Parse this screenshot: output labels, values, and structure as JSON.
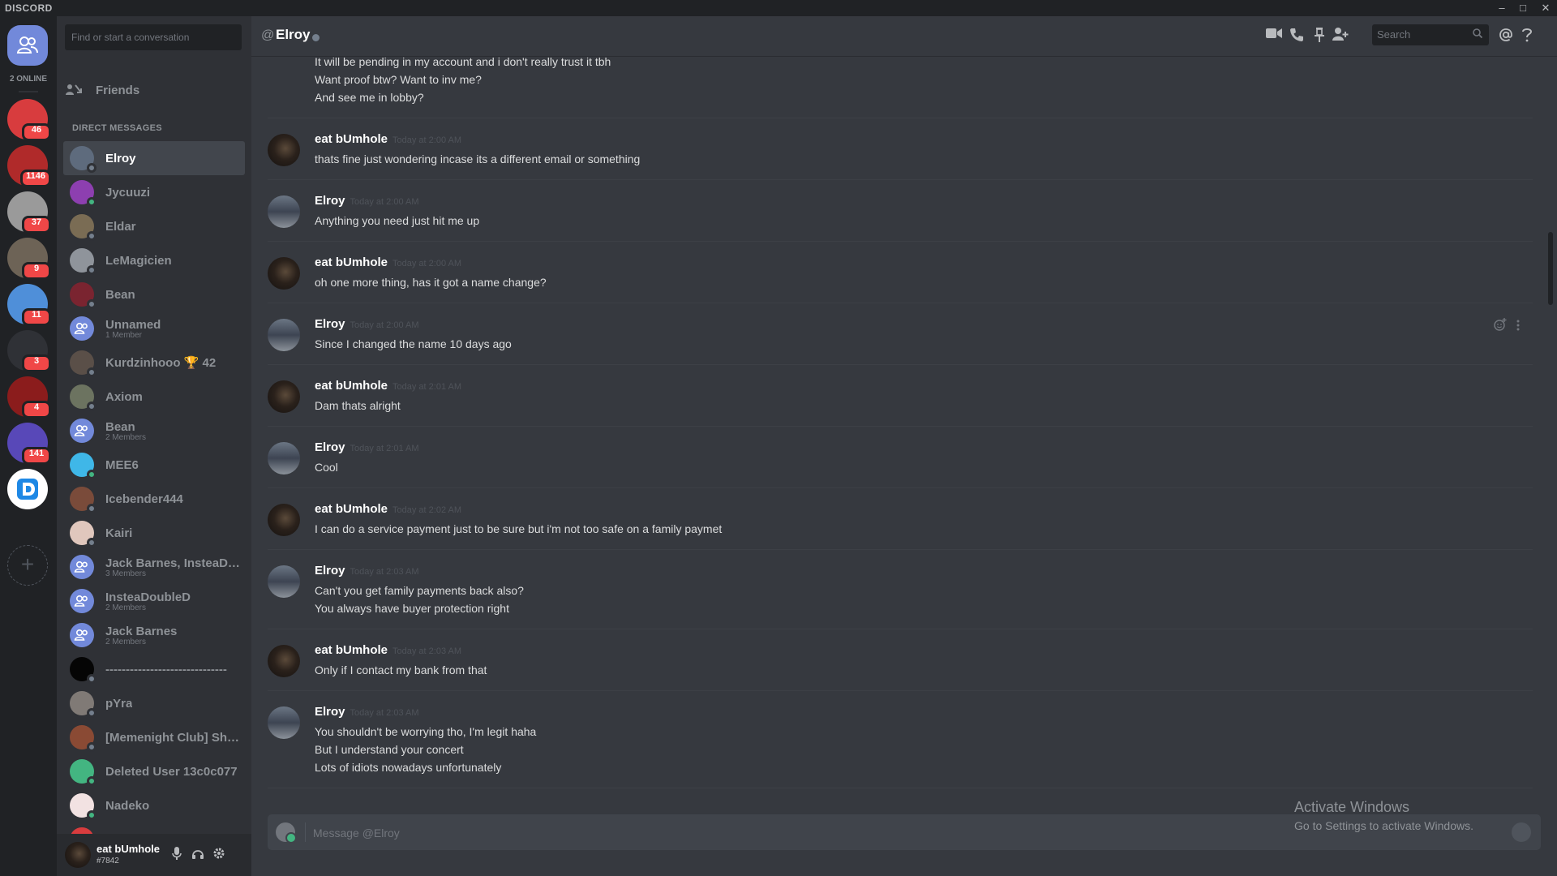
{
  "app": {
    "brand": "DISCORD"
  },
  "window_controls": {
    "minimize": "–",
    "maximize": "□",
    "close": "✕"
  },
  "rail": {
    "online_count": "2 ONLINE",
    "guilds": [
      {
        "name": "guild-1",
        "badge": "46",
        "color": "#d83c3e"
      },
      {
        "name": "guild-2",
        "badge": "1146",
        "color": "#b02a2a"
      },
      {
        "name": "guild-3",
        "badge": "37",
        "color": "#9a9a9a"
      },
      {
        "name": "guild-4",
        "badge": "9",
        "color": "#6d6356"
      },
      {
        "name": "guild-5",
        "badge": "11",
        "color": "#4f8fd9"
      },
      {
        "name": "guild-6",
        "badge": "3",
        "color": "#2f3136"
      },
      {
        "name": "guild-7",
        "badge": "4",
        "color": "#8b1c1c"
      },
      {
        "name": "guild-8",
        "badge": "141",
        "color": "#5848b8"
      },
      {
        "name": "guild-9",
        "badge": "",
        "color": "#ffffff"
      }
    ]
  },
  "dm": {
    "search_placeholder": "Find or start a conversation",
    "friends_label": "Friends",
    "header": "DIRECT MESSAGES",
    "items": [
      {
        "name": "Elroy",
        "sub": "",
        "active": true,
        "online": false,
        "color": "#5e6b7d"
      },
      {
        "name": "Jycuuzi",
        "sub": "",
        "active": false,
        "online": true,
        "color": "#8d3fb0"
      },
      {
        "name": "Eldar",
        "sub": "",
        "active": false,
        "online": false,
        "color": "#7a6c54"
      },
      {
        "name": "LeMagicien",
        "sub": "",
        "active": false,
        "online": false,
        "color": "#8f949b"
      },
      {
        "name": "Bean",
        "sub": "",
        "active": false,
        "online": false,
        "color": "#7a2430"
      },
      {
        "name": "Unnamed",
        "sub": "1 Member",
        "active": false,
        "online": false,
        "color": "#7289da"
      },
      {
        "name": "Kurdzinhooo 🏆 42",
        "sub": "",
        "active": false,
        "online": false,
        "color": "#5a4f48"
      },
      {
        "name": "Axiom",
        "sub": "",
        "active": false,
        "online": false,
        "color": "#6c7360"
      },
      {
        "name": "Bean",
        "sub": "2 Members",
        "active": false,
        "online": false,
        "color": "#7289da"
      },
      {
        "name": "MEE6",
        "sub": "",
        "active": false,
        "online": true,
        "color": "#3fb7e8"
      },
      {
        "name": "Icebender444",
        "sub": "",
        "active": false,
        "online": false,
        "color": "#7a4b3a"
      },
      {
        "name": "Kairi",
        "sub": "",
        "active": false,
        "online": false,
        "color": "#e0c7bd"
      },
      {
        "name": "Jack Barnes, InsteaDoub...",
        "sub": "3 Members",
        "active": false,
        "online": false,
        "color": "#7289da"
      },
      {
        "name": "InsteaDoubleD",
        "sub": "2 Members",
        "active": false,
        "online": false,
        "color": "#7289da"
      },
      {
        "name": "Jack Barnes",
        "sub": "2 Members",
        "active": false,
        "online": false,
        "color": "#7289da"
      },
      {
        "name": "------------------------------",
        "sub": "",
        "active": false,
        "online": false,
        "color": "#050505"
      },
      {
        "name": "pYra",
        "sub": "",
        "active": false,
        "online": false,
        "color": "#807a76"
      },
      {
        "name": "[Memenight Club] Shai ...",
        "sub": "",
        "active": false,
        "online": false,
        "color": "#8a4a34"
      },
      {
        "name": "Deleted User 13c0c077",
        "sub": "",
        "active": false,
        "online": true,
        "color": "#43b581"
      },
      {
        "name": "Nadeko",
        "sub": "",
        "active": false,
        "online": true,
        "color": "#f2e2e2"
      },
      {
        "name": "",
        "sub": "",
        "active": false,
        "online": false,
        "color": "#d83c3e"
      }
    ]
  },
  "user_panel": {
    "name": "eat bUmhole",
    "tag": "#7842"
  },
  "chat": {
    "at_symbol": "@",
    "title": "Elroy",
    "search_placeholder": "Search",
    "composer_placeholder": "Message @Elroy",
    "messages": [
      {
        "author": "",
        "time": "",
        "lines": [
          "It will be pending in my account and i don't really trust it tbh",
          "Want proof btw? Want to inv me?",
          "And see me in lobby?"
        ]
      },
      {
        "author": "eat bUmhole",
        "time": "Today at 2:00 AM",
        "lines": [
          "thats fine just wondering incase its a different email or something"
        ]
      },
      {
        "author": "Elroy",
        "time": "Today at 2:00 AM",
        "lines": [
          "Anything you need just hit me up"
        ]
      },
      {
        "author": "eat bUmhole",
        "time": "Today at 2:00 AM",
        "lines": [
          "oh one more thing, has it got a name change?"
        ]
      },
      {
        "author": "Elroy",
        "time": "Today at 2:00 AM",
        "lines": [
          "Since I changed the name 10 days ago"
        ]
      },
      {
        "author": "eat bUmhole",
        "time": "Today at 2:01 AM",
        "lines": [
          "Dam thats alright"
        ]
      },
      {
        "author": "Elroy",
        "time": "Today at 2:01 AM",
        "lines": [
          "Cool"
        ]
      },
      {
        "author": "eat bUmhole",
        "time": "Today at 2:02 AM",
        "lines": [
          "I can do  a service payment just to be sure but i'm not too safe on a family paymet"
        ]
      },
      {
        "author": "Elroy",
        "time": "Today at 2:03 AM",
        "lines": [
          "Can't you get family payments back also?",
          "You always have buyer protection right"
        ]
      },
      {
        "author": "eat bUmhole",
        "time": "Today at 2:03 AM",
        "lines": [
          "Only if I contact my bank from that"
        ]
      },
      {
        "author": "Elroy",
        "time": "Today at 2:03 AM",
        "lines": [
          "You shouldn't be worrying tho, I'm legit haha",
          "But I understand your concert",
          "Lots of idiots nowadays unfortunately"
        ]
      }
    ]
  },
  "watermark": {
    "line1": "Activate Windows",
    "line2": "Go to Settings to activate Windows."
  }
}
